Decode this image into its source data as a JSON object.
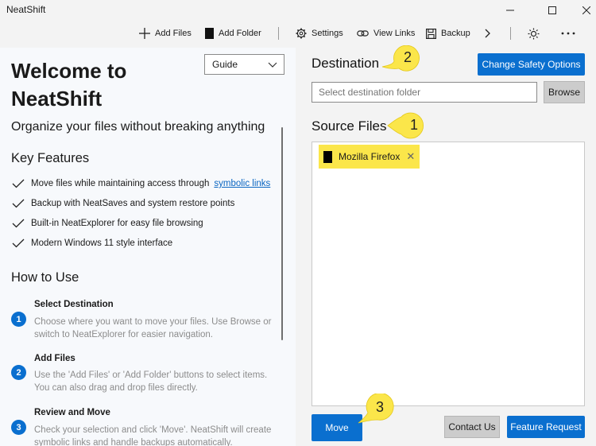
{
  "window": {
    "title": "NeatShift"
  },
  "toolbar": {
    "add_files": "Add Files",
    "add_folder": "Add Folder",
    "settings": "Settings",
    "view_links": "View Links",
    "backup": "Backup"
  },
  "left": {
    "title": "Welcome to NeatShift",
    "guide_select": "Guide",
    "tagline": "Organize your files without breaking anything",
    "features_heading": "Key Features",
    "features": [
      {
        "text": "Move files while maintaining access through",
        "link": "symbolic links"
      },
      {
        "text": "Backup with NeatSaves and system restore points"
      },
      {
        "text": "Built-in NeatExplorer for easy file browsing"
      },
      {
        "text": "Modern Windows 11 style interface"
      }
    ],
    "howto_heading": "How to Use",
    "steps": [
      {
        "num": "1",
        "title": "Select Destination",
        "desc": "Choose where you want to move your files. Use Browse or switch to NeatExplorer for easier navigation."
      },
      {
        "num": "2",
        "title": "Add Files",
        "desc": "Use the 'Add Files' or 'Add Folder' buttons to select items. You can also drag and drop files directly."
      },
      {
        "num": "3",
        "title": "Review and Move",
        "desc": "Check your selection and click 'Move'. NeatShift will create symbolic links and handle backups automatically."
      }
    ]
  },
  "right": {
    "destination_heading": "Destination",
    "change_safety": "Change Safety Options",
    "destination_placeholder": "Select destination folder",
    "browse": "Browse",
    "source_heading": "Source Files",
    "source_files": [
      {
        "name": "Mozilla Firefox"
      }
    ],
    "move": "Move",
    "contact": "Contact Us",
    "feature_request": "Feature Request"
  },
  "callouts": {
    "destination": "2",
    "source": "1",
    "move": "3"
  },
  "colors": {
    "accent": "#0a6fcf",
    "highlight": "#fbe64a",
    "muted_text": "#8c8c8c"
  }
}
